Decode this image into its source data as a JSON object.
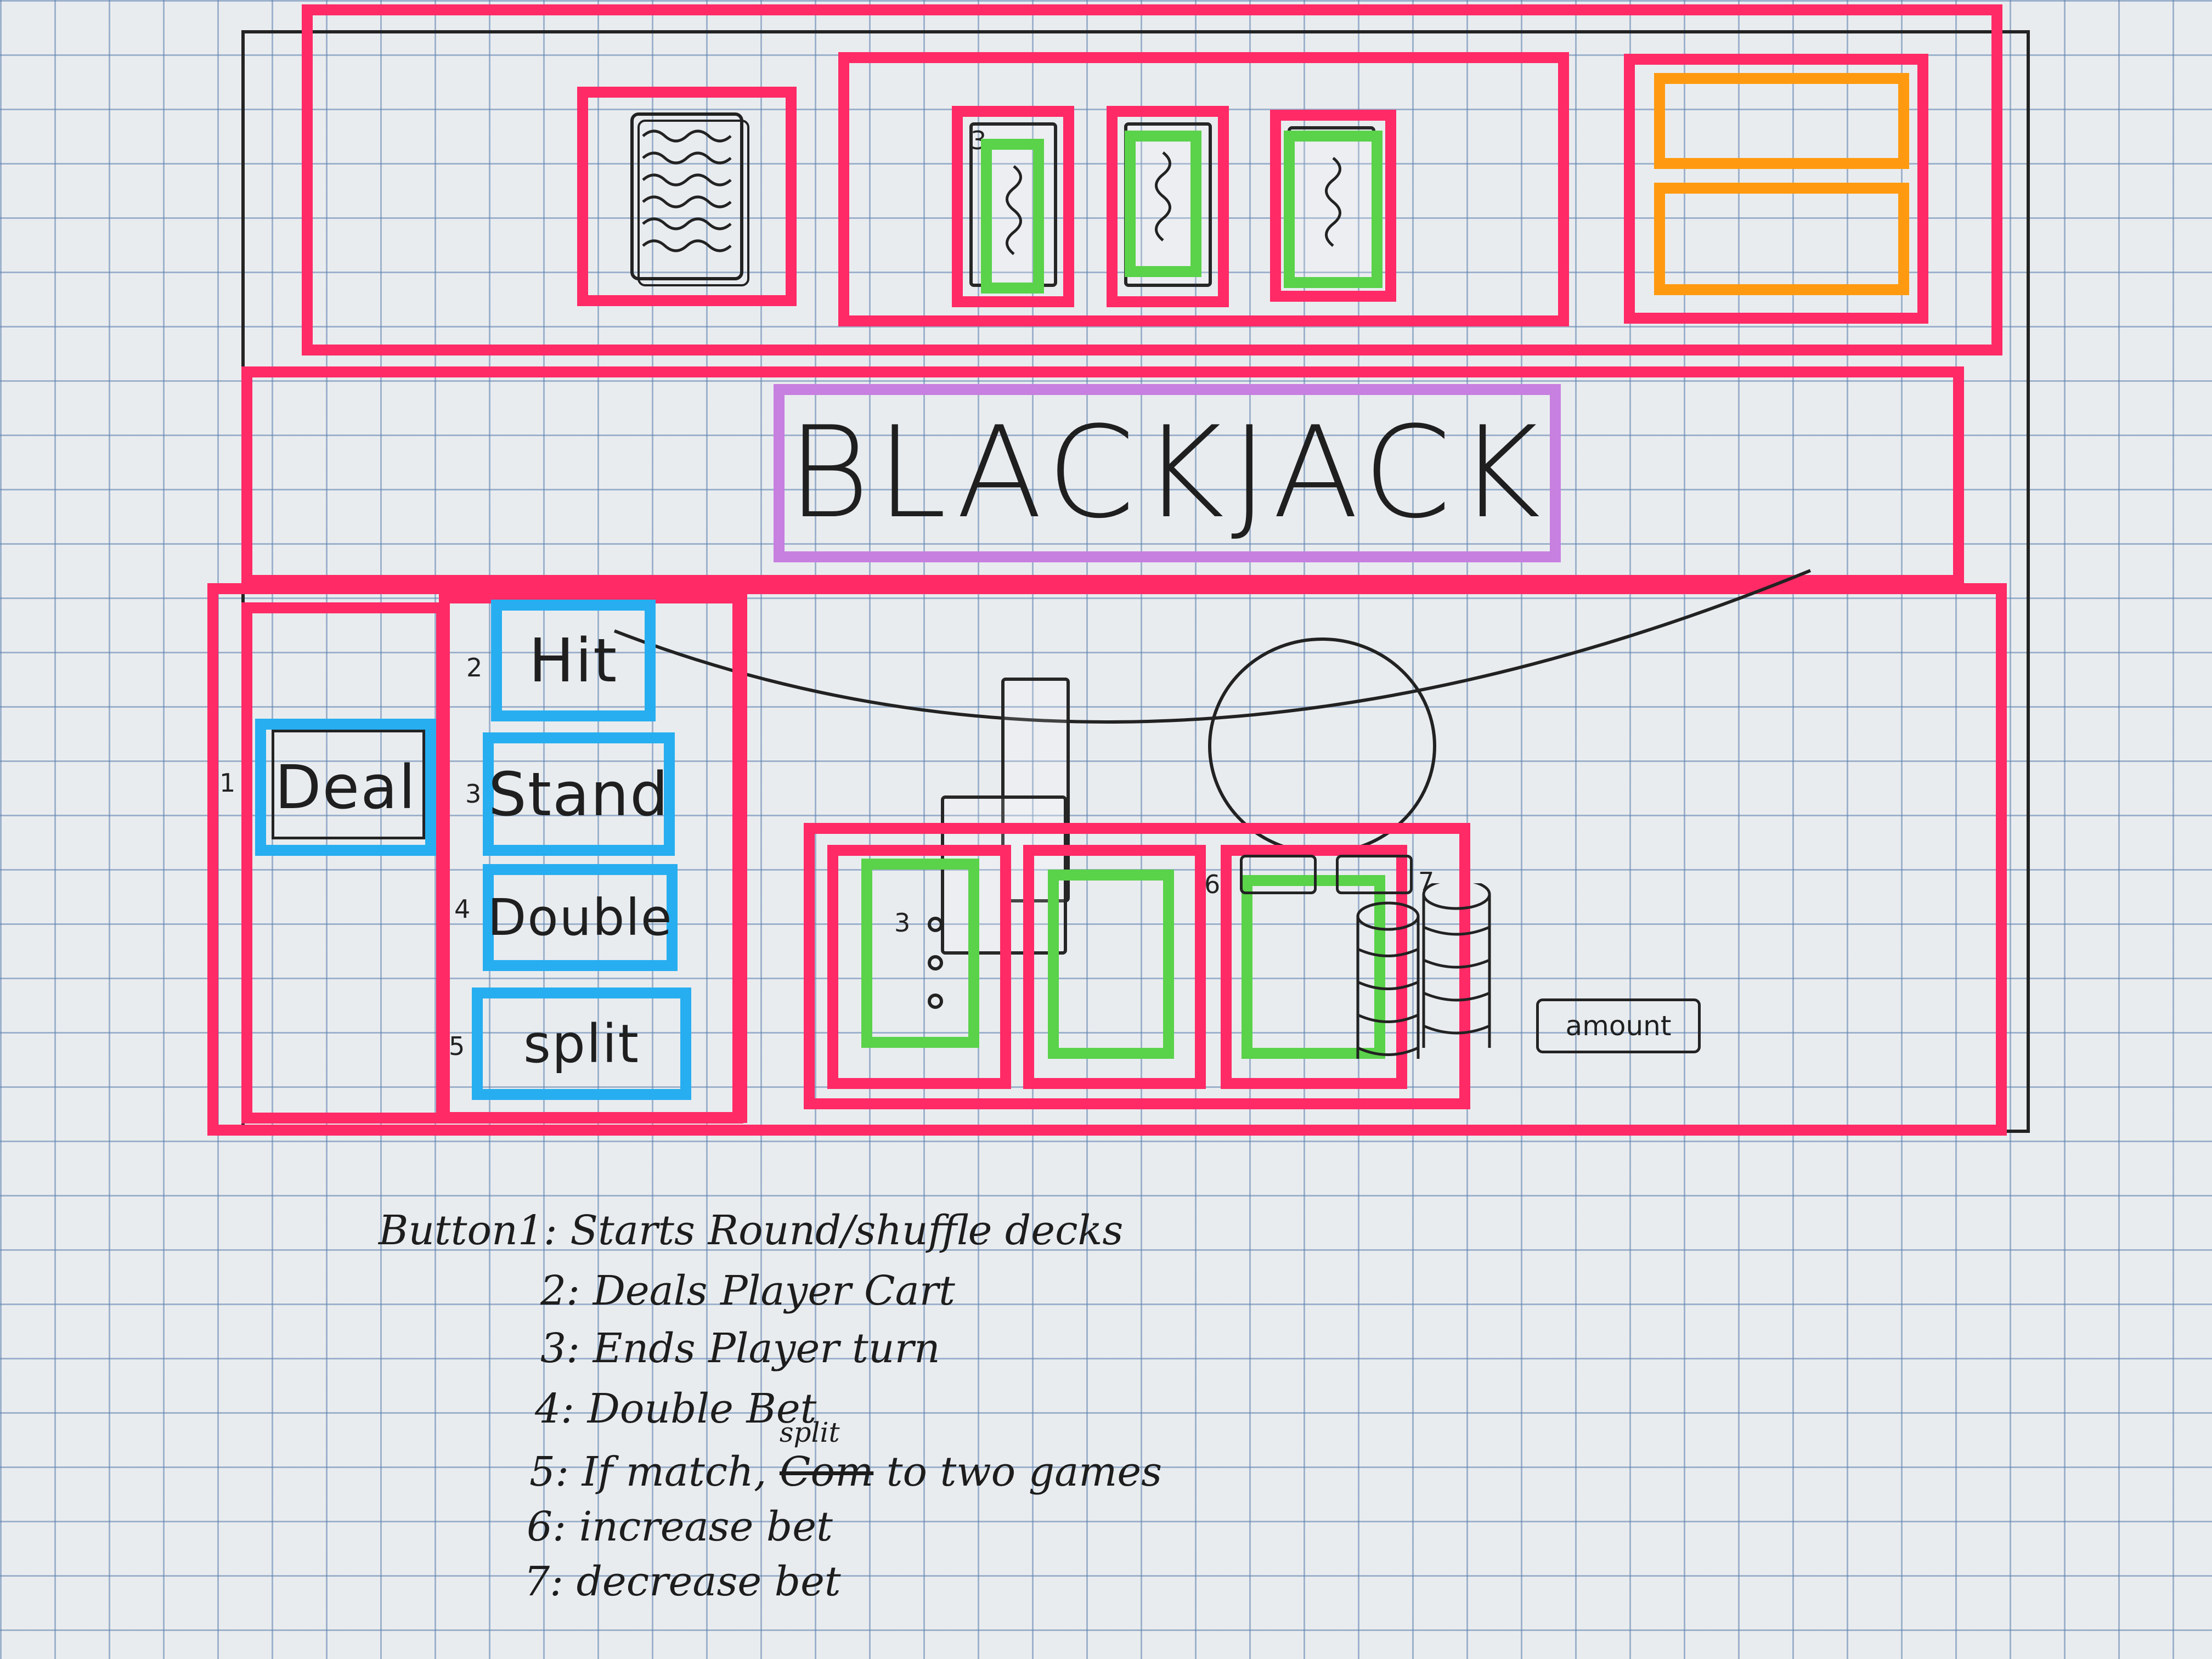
{
  "title": "BLACKJACK",
  "colors": {
    "container": "#ff2a66",
    "button": "#27aef0",
    "card": "#5ad24a",
    "score": "#ff9a10",
    "title_box": "#c77fe0"
  },
  "buttons": [
    {
      "number": "1",
      "label": "Deal"
    },
    {
      "number": "2",
      "label": "Hit"
    },
    {
      "number": "3",
      "label": "Stand"
    },
    {
      "number": "4",
      "label": "Double"
    },
    {
      "number": "5",
      "label": "split"
    }
  ],
  "bet_controls": {
    "increase_number": "6",
    "decrease_number": "7",
    "amount_label": "amount"
  },
  "card_marks": {
    "dealer_card": "3",
    "player_card": "3"
  },
  "legend": {
    "heading": "Button",
    "items": [
      {
        "number": "1",
        "text": "Starts Round/shuffle decks"
      },
      {
        "number": "2",
        "text": "Deals Player Cart"
      },
      {
        "number": "3",
        "text": "Ends Player turn"
      },
      {
        "number": "4",
        "text": "Double Bet"
      },
      {
        "number": "5",
        "text_before": "If match,",
        "struck": "Com",
        "insert": "split",
        "text_after": "to two games"
      },
      {
        "number": "6",
        "text": "increase bet"
      },
      {
        "number": "7",
        "text": "decrease bet"
      }
    ]
  }
}
